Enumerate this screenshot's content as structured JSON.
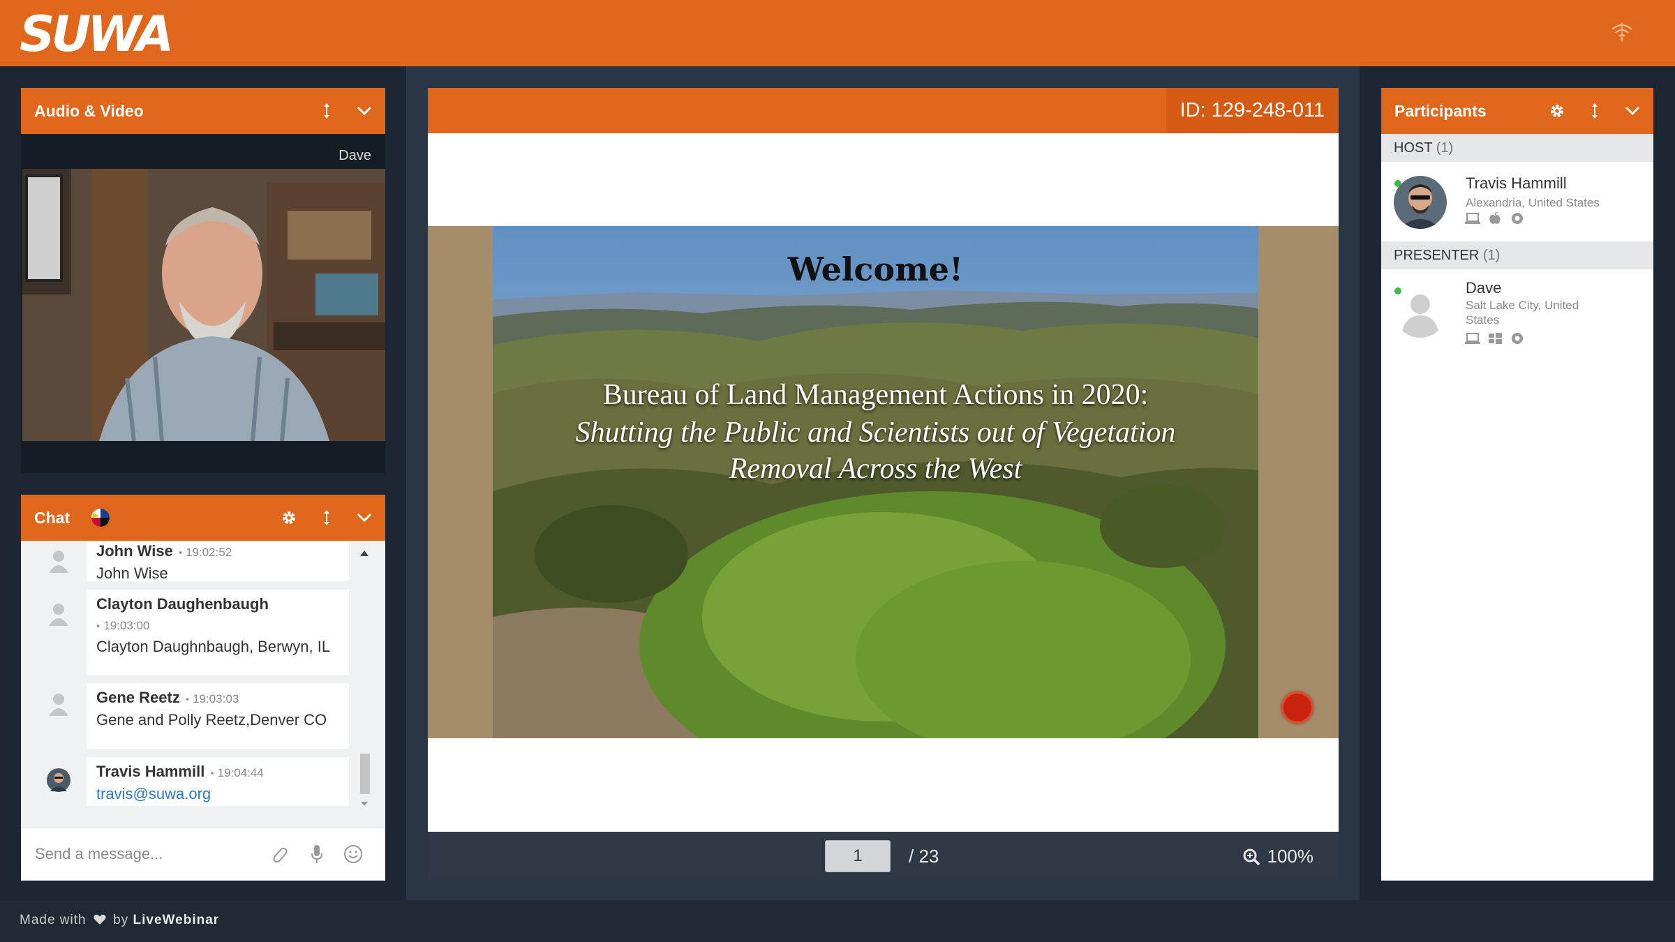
{
  "brand": {
    "logo": "SUWA",
    "accent": "#e0661b"
  },
  "av_panel": {
    "title": "Audio & Video",
    "video_name": "Dave"
  },
  "chat": {
    "title": "Chat",
    "messages": [
      {
        "author": "John Wise",
        "time": "19:02:52",
        "text": "John Wise"
      },
      {
        "author": "Clayton Daughenbaugh",
        "time": "19:03:00",
        "text": "Clayton Daughnbaugh, Berwyn, IL"
      },
      {
        "author": "Gene Reetz",
        "time": "19:03:03",
        "text": "Gene and Polly Reetz,Denver CO"
      },
      {
        "author": "Travis Hammill",
        "time": "19:04:44",
        "text": "travis@suwa.org"
      }
    ],
    "placeholder": "Send a message..."
  },
  "presentation": {
    "id_label": "ID: 129-248-011",
    "slide": {
      "title": "Welcome!",
      "line1": "Bureau of Land Management Actions in 2020:",
      "line2": "Shutting the Public and Scientists out of Vegetation",
      "line3": "Removal Across the West"
    },
    "page": "1",
    "total": "/ 23",
    "zoom": "100%"
  },
  "participants": {
    "title": "Participants",
    "host_label": "HOST",
    "host_count": "(1)",
    "host": {
      "name": "Travis Hammill",
      "location": "Alexandria, United States"
    },
    "presenter_label": "PRESENTER",
    "presenter_count": "(1)",
    "presenter": {
      "name": "Dave",
      "location": "Salt Lake City, United States"
    }
  },
  "footer": {
    "made_with": "Made with",
    "by": "by",
    "brand": "LiveWebinar"
  }
}
